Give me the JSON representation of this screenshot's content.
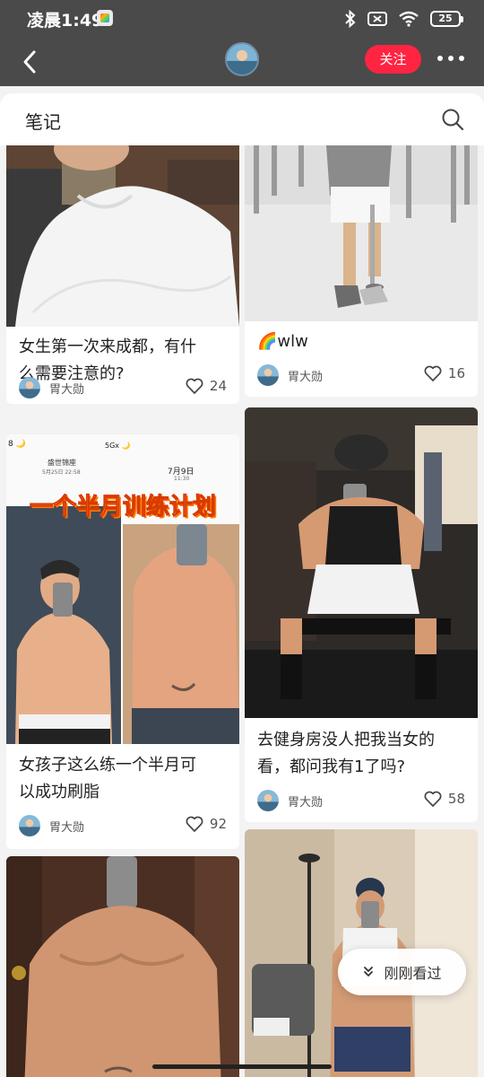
{
  "status_bar": {
    "time": "凌晨1:49",
    "battery": "25"
  },
  "profile_bar": {
    "follow_label": "关注"
  },
  "notes_panel": {
    "title": "笔记"
  },
  "notes": [
    {
      "title_lines": [
        "女生第一次来成都，有什",
        "么需要注意的?"
      ],
      "author": "胃大勋",
      "likes": "24"
    },
    {
      "title_lines": [
        "🌈wlw"
      ],
      "author": "胃大勋",
      "likes": "16"
    },
    {
      "title_lines": [
        "女孩子这么练一个半月可",
        "以成功刷脂"
      ],
      "author": "胃大勋",
      "likes": "92",
      "image_overlay": {
        "caption": "一个半月训练计划",
        "left_phone_top": "8 🌙",
        "left_phone_name": "盛世锦座",
        "left_phone_date": "5月25日 22:58",
        "right_phone_signal": "5Gx 🌙",
        "right_phone_date": "7月9日",
        "right_phone_time": "11:30"
      }
    },
    {
      "title_lines": [
        "去健身房没人把我当女的",
        "看，都问我有1了吗?"
      ],
      "author": "胃大勋",
      "likes": "58"
    }
  ],
  "recently_viewed": {
    "label": "刚刚看过"
  },
  "colors": {
    "accent": "#ff2442",
    "dark_bar": "#4a4a4a"
  },
  "icons": [
    "back-arrow-icon",
    "search-icon",
    "heart-icon",
    "chevron-double-down-icon",
    "bluetooth-icon",
    "wifi-icon",
    "sim-icon"
  ]
}
